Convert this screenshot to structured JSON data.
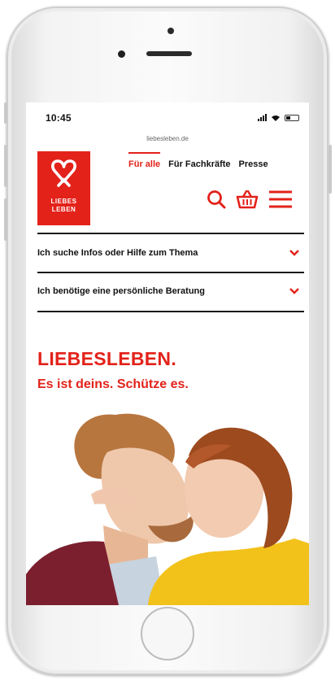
{
  "status": {
    "time": "10:45"
  },
  "browser": {
    "url": "liebesleben.de"
  },
  "logo": {
    "line1": "LIEBES",
    "line2": "LEBEN"
  },
  "nav": {
    "items": [
      {
        "label": "Für alle",
        "active": true
      },
      {
        "label": "Für Fachkräfte"
      },
      {
        "label": "Presse"
      }
    ]
  },
  "icons": [
    "search-icon",
    "basket-icon",
    "menu-icon"
  ],
  "accordion": [
    {
      "label": "Ich suche Infos oder Hilfe zum Thema"
    },
    {
      "label": "Ich benötige eine persönliche Beratung"
    }
  ],
  "hero": {
    "headline": "LIEBESLEBEN.",
    "subline": "Es ist deins. Schütze es."
  },
  "colors": {
    "accent": "#e3221a",
    "text": "#111111"
  }
}
